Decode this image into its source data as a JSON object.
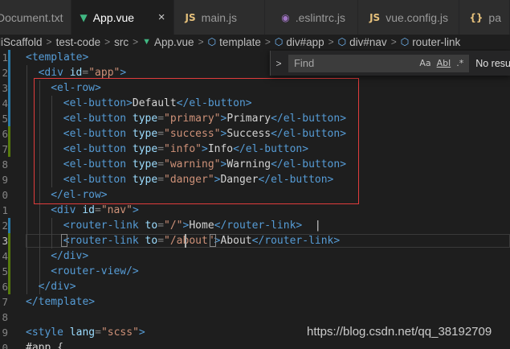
{
  "tabs": [
    {
      "label": "Document.txt",
      "icon": "text-file-icon",
      "active": false
    },
    {
      "label": "App.vue",
      "icon": "vue-icon",
      "active": true,
      "close": "×"
    },
    {
      "label": "main.js",
      "icon": "js-icon",
      "active": false
    },
    {
      "label": ".eslintrc.js",
      "icon": "eslint-icon",
      "active": false
    },
    {
      "label": "vue.config.js",
      "icon": "js-icon",
      "active": false
    },
    {
      "label": "pa",
      "icon": "json-icon",
      "active": false
    }
  ],
  "breadcrumb": [
    "liScaffold",
    "test-code",
    "src",
    "App.vue",
    "template",
    "div#app",
    "div#nav",
    "router-link"
  ],
  "find": {
    "placeholder": "Find",
    "toggle": ">",
    "match_case": "Aa",
    "whole_word": "Abl",
    "regex": ".*",
    "result": "No resu"
  },
  "code": {
    "line_numbers": [
      "1",
      "2",
      "3",
      "4",
      "5",
      "6",
      "7",
      "8",
      "9",
      "0",
      "1",
      "2",
      "3",
      "4",
      "5",
      "6",
      "7",
      "8",
      "9",
      "0"
    ],
    "current_line_index": 12,
    "lines": [
      [
        [
          "tag",
          "<template>"
        ]
      ],
      [
        [
          "tag",
          "<div "
        ],
        [
          "attr",
          "id"
        ],
        [
          "punct",
          "="
        ],
        [
          "str",
          "\"app\""
        ],
        [
          "tag",
          ">"
        ]
      ],
      [
        [
          "tag",
          "<el-row>"
        ]
      ],
      [
        [
          "tag",
          "<el-button>"
        ],
        [
          "txt",
          "Default"
        ],
        [
          "tag",
          "</el-button>"
        ]
      ],
      [
        [
          "tag",
          "<el-button "
        ],
        [
          "attr",
          "type"
        ],
        [
          "punct",
          "="
        ],
        [
          "str",
          "\"primary\""
        ],
        [
          "tag",
          ">"
        ],
        [
          "txt",
          "Primary"
        ],
        [
          "tag",
          "</el-button>"
        ]
      ],
      [
        [
          "tag",
          "<el-button "
        ],
        [
          "attr",
          "type"
        ],
        [
          "punct",
          "="
        ],
        [
          "str",
          "\"success\""
        ],
        [
          "tag",
          ">"
        ],
        [
          "txt",
          "Success"
        ],
        [
          "tag",
          "</el-button>"
        ]
      ],
      [
        [
          "tag",
          "<el-button "
        ],
        [
          "attr",
          "type"
        ],
        [
          "punct",
          "="
        ],
        [
          "str",
          "\"info\""
        ],
        [
          "tag",
          ">"
        ],
        [
          "txt",
          "Info"
        ],
        [
          "tag",
          "</el-button>"
        ]
      ],
      [
        [
          "tag",
          "<el-button "
        ],
        [
          "attr",
          "type"
        ],
        [
          "punct",
          "="
        ],
        [
          "str",
          "\"warning\""
        ],
        [
          "tag",
          ">"
        ],
        [
          "txt",
          "Warning"
        ],
        [
          "tag",
          "</el-button>"
        ]
      ],
      [
        [
          "tag",
          "<el-button "
        ],
        [
          "attr",
          "type"
        ],
        [
          "punct",
          "="
        ],
        [
          "str",
          "\"danger\""
        ],
        [
          "tag",
          ">"
        ],
        [
          "txt",
          "Danger"
        ],
        [
          "tag",
          "</el-button>"
        ]
      ],
      [
        [
          "tag",
          "</el-row>"
        ]
      ],
      [
        [
          "tag",
          "<div "
        ],
        [
          "attr",
          "id"
        ],
        [
          "punct",
          "="
        ],
        [
          "str",
          "\"nav\""
        ],
        [
          "tag",
          ">"
        ]
      ],
      [
        [
          "tag",
          "<router-link "
        ],
        [
          "attr",
          "to"
        ],
        [
          "punct",
          "="
        ],
        [
          "str",
          "\"/\""
        ],
        [
          "tag",
          ">"
        ],
        [
          "txt",
          "Home"
        ],
        [
          "tag",
          "</router-link>"
        ],
        [
          "txt",
          "  |"
        ]
      ],
      [
        [
          "tag",
          "<router-link "
        ],
        [
          "attr",
          "to"
        ],
        [
          "punct",
          "="
        ],
        [
          "str",
          "\"/about\""
        ],
        [
          "tag",
          ">"
        ],
        [
          "txt",
          "About"
        ],
        [
          "tag",
          "</router-link>"
        ]
      ],
      [
        [
          "tag",
          "</div>"
        ]
      ],
      [
        [
          "tag",
          "<router-view/>"
        ]
      ],
      [
        [
          "tag",
          "</div>"
        ]
      ],
      [
        [
          "tag",
          "</template>"
        ]
      ],
      [
        [
          "txt",
          ""
        ]
      ],
      [
        [
          "tag",
          "<style "
        ],
        [
          "attr",
          "lang"
        ],
        [
          "punct",
          "="
        ],
        [
          "str",
          "\"scss\""
        ],
        [
          "tag",
          ">"
        ]
      ],
      [
        [
          "txt",
          "#app {"
        ]
      ]
    ]
  },
  "watermark": "https://blog.csdn.net/qq_38192709",
  "colors": {
    "background": "#1e1e1e",
    "highlight_box": "#e03c3c",
    "modified_bar": "#587c0c",
    "added_bar": "#2a7aa8"
  }
}
